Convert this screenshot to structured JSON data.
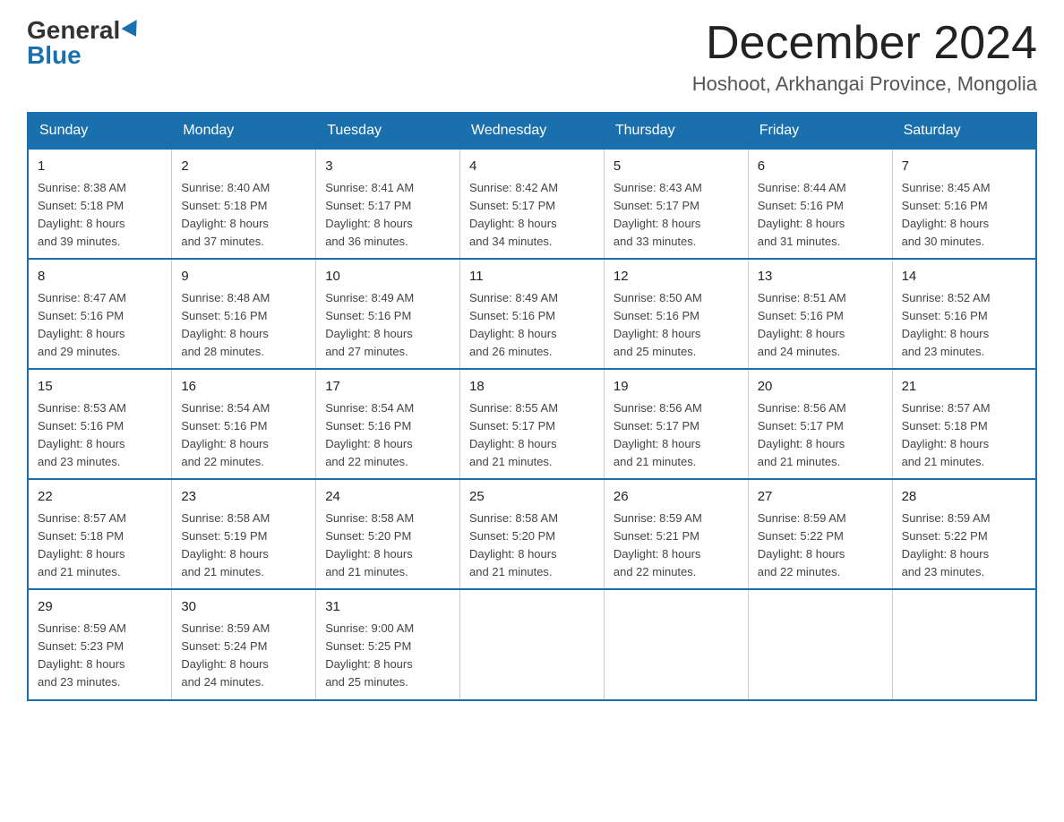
{
  "logo": {
    "general": "General",
    "blue": "Blue"
  },
  "header": {
    "month_year": "December 2024",
    "location": "Hoshoot, Arkhangai Province, Mongolia"
  },
  "weekdays": [
    "Sunday",
    "Monday",
    "Tuesday",
    "Wednesday",
    "Thursday",
    "Friday",
    "Saturday"
  ],
  "weeks": [
    [
      {
        "day": "1",
        "info": "Sunrise: 8:38 AM\nSunset: 5:18 PM\nDaylight: 8 hours\nand 39 minutes."
      },
      {
        "day": "2",
        "info": "Sunrise: 8:40 AM\nSunset: 5:18 PM\nDaylight: 8 hours\nand 37 minutes."
      },
      {
        "day": "3",
        "info": "Sunrise: 8:41 AM\nSunset: 5:17 PM\nDaylight: 8 hours\nand 36 minutes."
      },
      {
        "day": "4",
        "info": "Sunrise: 8:42 AM\nSunset: 5:17 PM\nDaylight: 8 hours\nand 34 minutes."
      },
      {
        "day": "5",
        "info": "Sunrise: 8:43 AM\nSunset: 5:17 PM\nDaylight: 8 hours\nand 33 minutes."
      },
      {
        "day": "6",
        "info": "Sunrise: 8:44 AM\nSunset: 5:16 PM\nDaylight: 8 hours\nand 31 minutes."
      },
      {
        "day": "7",
        "info": "Sunrise: 8:45 AM\nSunset: 5:16 PM\nDaylight: 8 hours\nand 30 minutes."
      }
    ],
    [
      {
        "day": "8",
        "info": "Sunrise: 8:47 AM\nSunset: 5:16 PM\nDaylight: 8 hours\nand 29 minutes."
      },
      {
        "day": "9",
        "info": "Sunrise: 8:48 AM\nSunset: 5:16 PM\nDaylight: 8 hours\nand 28 minutes."
      },
      {
        "day": "10",
        "info": "Sunrise: 8:49 AM\nSunset: 5:16 PM\nDaylight: 8 hours\nand 27 minutes."
      },
      {
        "day": "11",
        "info": "Sunrise: 8:49 AM\nSunset: 5:16 PM\nDaylight: 8 hours\nand 26 minutes."
      },
      {
        "day": "12",
        "info": "Sunrise: 8:50 AM\nSunset: 5:16 PM\nDaylight: 8 hours\nand 25 minutes."
      },
      {
        "day": "13",
        "info": "Sunrise: 8:51 AM\nSunset: 5:16 PM\nDaylight: 8 hours\nand 24 minutes."
      },
      {
        "day": "14",
        "info": "Sunrise: 8:52 AM\nSunset: 5:16 PM\nDaylight: 8 hours\nand 23 minutes."
      }
    ],
    [
      {
        "day": "15",
        "info": "Sunrise: 8:53 AM\nSunset: 5:16 PM\nDaylight: 8 hours\nand 23 minutes."
      },
      {
        "day": "16",
        "info": "Sunrise: 8:54 AM\nSunset: 5:16 PM\nDaylight: 8 hours\nand 22 minutes."
      },
      {
        "day": "17",
        "info": "Sunrise: 8:54 AM\nSunset: 5:16 PM\nDaylight: 8 hours\nand 22 minutes."
      },
      {
        "day": "18",
        "info": "Sunrise: 8:55 AM\nSunset: 5:17 PM\nDaylight: 8 hours\nand 21 minutes."
      },
      {
        "day": "19",
        "info": "Sunrise: 8:56 AM\nSunset: 5:17 PM\nDaylight: 8 hours\nand 21 minutes."
      },
      {
        "day": "20",
        "info": "Sunrise: 8:56 AM\nSunset: 5:17 PM\nDaylight: 8 hours\nand 21 minutes."
      },
      {
        "day": "21",
        "info": "Sunrise: 8:57 AM\nSunset: 5:18 PM\nDaylight: 8 hours\nand 21 minutes."
      }
    ],
    [
      {
        "day": "22",
        "info": "Sunrise: 8:57 AM\nSunset: 5:18 PM\nDaylight: 8 hours\nand 21 minutes."
      },
      {
        "day": "23",
        "info": "Sunrise: 8:58 AM\nSunset: 5:19 PM\nDaylight: 8 hours\nand 21 minutes."
      },
      {
        "day": "24",
        "info": "Sunrise: 8:58 AM\nSunset: 5:20 PM\nDaylight: 8 hours\nand 21 minutes."
      },
      {
        "day": "25",
        "info": "Sunrise: 8:58 AM\nSunset: 5:20 PM\nDaylight: 8 hours\nand 21 minutes."
      },
      {
        "day": "26",
        "info": "Sunrise: 8:59 AM\nSunset: 5:21 PM\nDaylight: 8 hours\nand 22 minutes."
      },
      {
        "day": "27",
        "info": "Sunrise: 8:59 AM\nSunset: 5:22 PM\nDaylight: 8 hours\nand 22 minutes."
      },
      {
        "day": "28",
        "info": "Sunrise: 8:59 AM\nSunset: 5:22 PM\nDaylight: 8 hours\nand 23 minutes."
      }
    ],
    [
      {
        "day": "29",
        "info": "Sunrise: 8:59 AM\nSunset: 5:23 PM\nDaylight: 8 hours\nand 23 minutes."
      },
      {
        "day": "30",
        "info": "Sunrise: 8:59 AM\nSunset: 5:24 PM\nDaylight: 8 hours\nand 24 minutes."
      },
      {
        "day": "31",
        "info": "Sunrise: 9:00 AM\nSunset: 5:25 PM\nDaylight: 8 hours\nand 25 minutes."
      },
      {
        "day": "",
        "info": ""
      },
      {
        "day": "",
        "info": ""
      },
      {
        "day": "",
        "info": ""
      },
      {
        "day": "",
        "info": ""
      }
    ]
  ]
}
